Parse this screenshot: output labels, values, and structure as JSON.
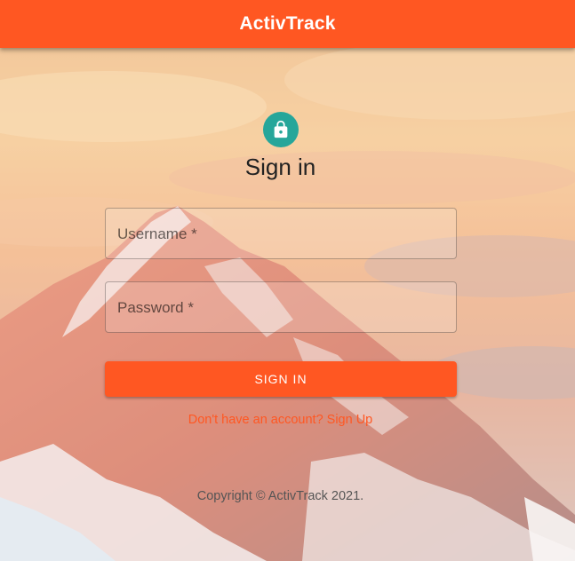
{
  "app": {
    "title": "ActivTrack",
    "accent_color": "#ff5722",
    "avatar_color": "#26a69a"
  },
  "background": {
    "description_icon": "mountain-sunset-photo"
  },
  "signin": {
    "icon": "lock-icon",
    "title": "Sign in",
    "username_label": "Username *",
    "username_value": "",
    "password_label": "Password *",
    "password_value": "",
    "button_label": "SIGN IN",
    "signup_link": "Don't have an account? Sign Up"
  },
  "footer": {
    "copyright": "Copyright © ActivTrack 2021."
  }
}
